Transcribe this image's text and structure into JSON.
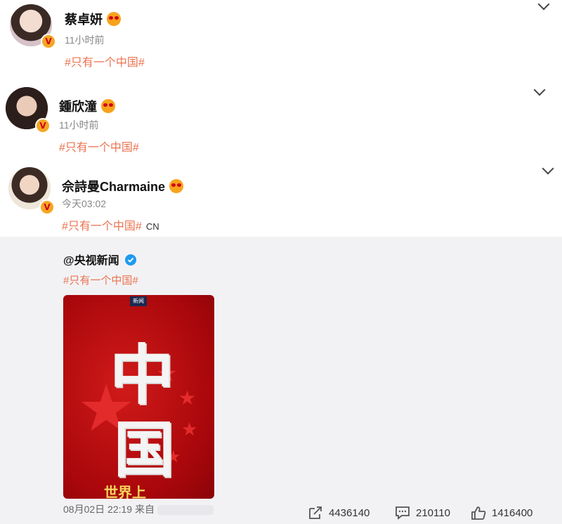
{
  "posts": [
    {
      "name": "蔡卓妍",
      "time": "11小时前",
      "tag": "#只有一个中国#"
    },
    {
      "name": "鍾欣潼",
      "time": "11小时前",
      "tag": "#只有一个中国#"
    },
    {
      "name": "佘詩曼Charmaine",
      "time": "今天03:02",
      "tag": "#只有一个中国#",
      "suffix": "CN"
    }
  ],
  "repost": {
    "author": "@央视新闻",
    "tag": "#只有一个中国#",
    "poster": {
      "logo": "新闻",
      "char1": "中",
      "char2": "国",
      "bottom": "世界上"
    },
    "footer_time": "08月02日 22:19 来自",
    "actions": {
      "share": "4436140",
      "comment": "210110",
      "like": "1416400"
    }
  },
  "colors": {
    "tag": "#eb7350",
    "verified_bg": "#f5a623",
    "poster_red": "#b30d10"
  },
  "icons": [
    "chevron-down-icon",
    "verified-icon",
    "share-icon",
    "comment-icon",
    "like-icon",
    "blue-verified-icon"
  ]
}
